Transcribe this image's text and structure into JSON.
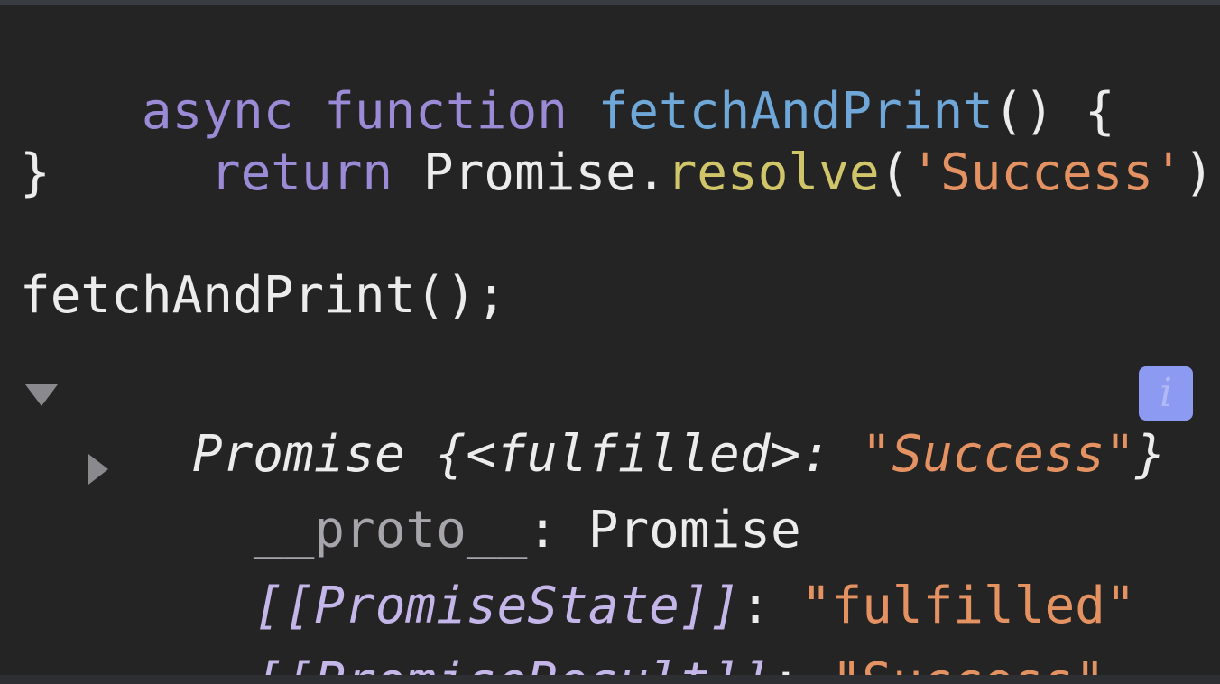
{
  "code": {
    "line1": {
      "kw_async": "async",
      "kw_function": "function",
      "fn_name": "fetchAndPrint",
      "rest": "() {"
    },
    "line2": {
      "kw_return": "return",
      "object": "Promise.",
      "method": "resolve",
      "open": "(",
      "arg": "'Success'",
      "close": ");"
    },
    "line3": {
      "text": "}"
    },
    "line4": {
      "text": "fetchAndPrint();"
    }
  },
  "console_output": {
    "summary": {
      "label": "Promise",
      "state_part": " {<fulfilled>: ",
      "value": "\"Success\"",
      "close": "}"
    },
    "info_icon_glyph": "i",
    "proto": {
      "key": "__proto__",
      "sep": ": ",
      "value": "Promise"
    },
    "state": {
      "key": "[[PromiseState]]",
      "sep": ": ",
      "value": "\"fulfilled\""
    },
    "result": {
      "key": "[[PromiseResult]]",
      "sep": ": ",
      "value": "\"Success\""
    }
  },
  "colors": {
    "background": "#242424",
    "keyword": "#9b8ad6",
    "function_name": "#6fa8d8",
    "method": "#d1c56a",
    "string": "#e59263",
    "internal_property": "#c5b6e9",
    "info_badge": "#8d9af2"
  }
}
